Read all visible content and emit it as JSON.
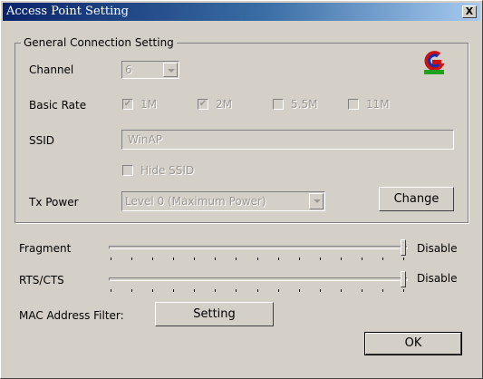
{
  "window": {
    "title": "Access Point Setting",
    "close_glyph": "X"
  },
  "group": {
    "label": "General Connection Setting"
  },
  "channel": {
    "label": "Channel",
    "value": "6"
  },
  "basic_rate": {
    "label": "Basic Rate",
    "options": [
      {
        "label": "1M",
        "checked": true
      },
      {
        "label": "2M",
        "checked": true
      },
      {
        "label": "5.5M",
        "checked": false
      },
      {
        "label": "11M",
        "checked": false
      }
    ]
  },
  "ssid": {
    "label": "SSID",
    "value": "WinAP"
  },
  "hide_ssid": {
    "label": "Hide SSID",
    "checked": false
  },
  "tx_power": {
    "label": "Tx Power",
    "value": "Level 0 (Maximum Power)",
    "change_label": "Change"
  },
  "fragment": {
    "label": "Fragment",
    "value_label": "Disable",
    "level": 1.0
  },
  "rts_cts": {
    "label": "RTS/CTS",
    "value_label": "Disable",
    "level": 1.0
  },
  "mac_filter": {
    "label": "MAC Address Filter:",
    "button_label": "Setting"
  },
  "ok_label": "OK",
  "colors": {
    "title_start": "#0a246a",
    "title_end": "#a6caf0",
    "face": "#d4d0c8",
    "disabled_text": "#9b9894",
    "logo_red": "#d01010",
    "logo_blue": "#1030b0",
    "logo_green": "#20a020"
  }
}
